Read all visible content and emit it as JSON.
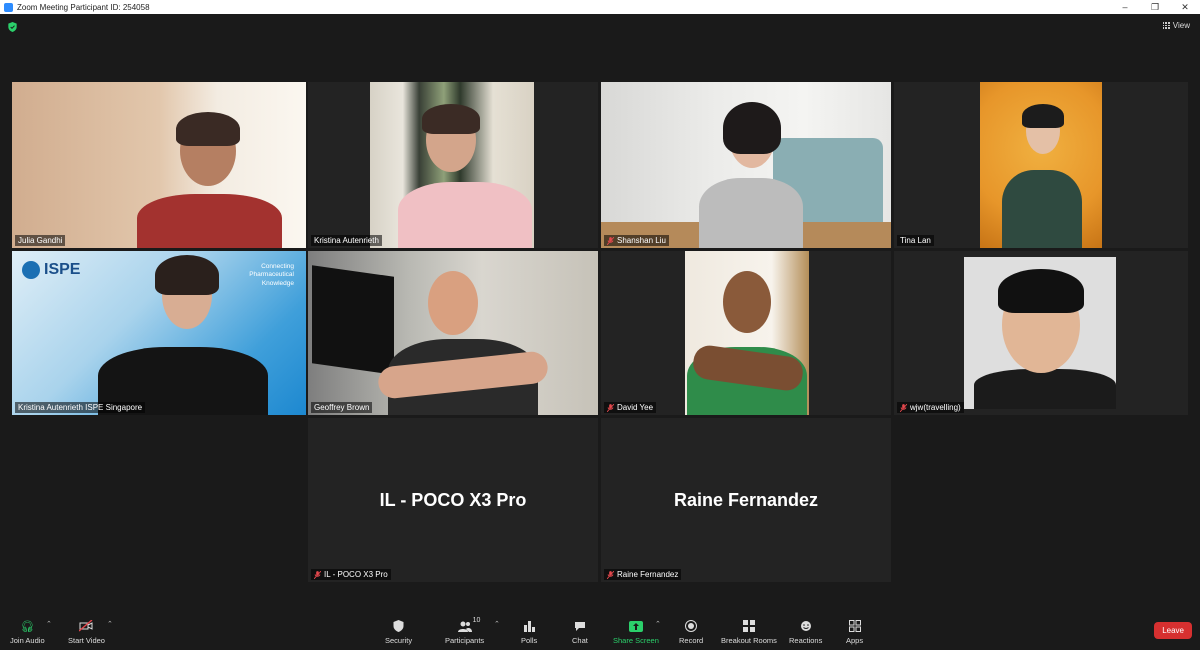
{
  "window": {
    "title": "Zoom Meeting Participant ID: 254058",
    "view_label": "View"
  },
  "tiles": [
    {
      "name": "Julia Gandhi",
      "muted": false,
      "speaking": true
    },
    {
      "name": "Kristina Autenrieth",
      "muted": false
    },
    {
      "name": "Shanshan Liu",
      "muted": true
    },
    {
      "name": "Tina Lan",
      "muted": false
    },
    {
      "name": "Kristina Autenrieth ISPE Singapore",
      "muted": false
    },
    {
      "name": "Geoffrey Brown",
      "muted": false
    },
    {
      "name": "David Yee",
      "muted": true
    },
    {
      "name": "wjw(travelling)",
      "muted": true
    },
    {
      "name": "IL - POCO X3 Pro",
      "muted": true,
      "video_off": true
    },
    {
      "name": "Raine Fernandez",
      "muted": true,
      "video_off": true
    }
  ],
  "ispe": {
    "logo": "ISPE",
    "tagline": "Connecting Pharmaceutical Knowledge"
  },
  "toolbar": {
    "join_audio": "Join Audio",
    "start_video": "Start Video",
    "security": "Security",
    "participants": "Participants",
    "participants_count": "10",
    "polls": "Polls",
    "chat": "Chat",
    "share_screen": "Share Screen",
    "record": "Record",
    "breakout_rooms": "Breakout Rooms",
    "reactions": "Reactions",
    "apps": "Apps",
    "leave": "Leave"
  },
  "colors": {
    "accent_green": "#2bd06b",
    "leave_red": "#d63030",
    "speaker_outline": "#d6e25a"
  }
}
